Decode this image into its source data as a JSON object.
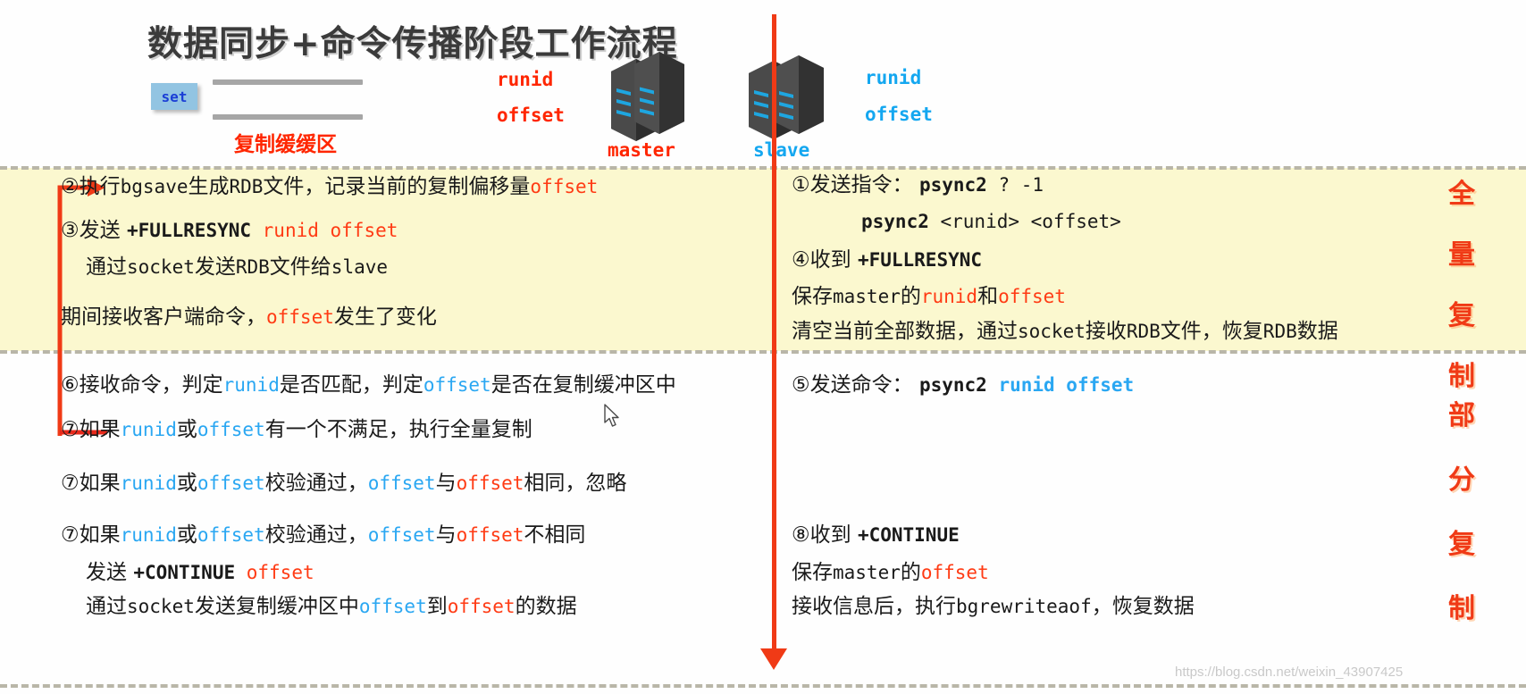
{
  "header": {
    "title": "数据同步+命令传播阶段工作流程",
    "set_box": "set",
    "buffer_label": "复制缓缓区",
    "master": {
      "runid": "runid",
      "offset": "offset",
      "name": "master"
    },
    "slave": {
      "runid": "runid",
      "offset": "offset",
      "name": "slave"
    }
  },
  "side_captions": {
    "full_replication": [
      "全",
      "量",
      "复",
      "制"
    ],
    "partial_replication": [
      "部",
      "分",
      "复",
      "制"
    ]
  },
  "master_panel": {
    "full": [
      {
        "id": "step2",
        "parts": [
          {
            "t": "②执行",
            "c": "black"
          },
          {
            "t": "bgsave",
            "c": "black",
            "mono": true
          },
          {
            "t": "生成",
            "c": "black"
          },
          {
            "t": "RDB",
            "c": "black",
            "mono": true
          },
          {
            "t": "文件，记录当前的复制偏移量",
            "c": "black"
          },
          {
            "t": "offset",
            "c": "red",
            "mono": true
          }
        ]
      },
      {
        "id": "step3",
        "parts": [
          {
            "t": "③发送 ",
            "c": "black"
          },
          {
            "t": "+FULLRESYNC ",
            "c": "black",
            "mono": true,
            "bold": true
          },
          {
            "t": "runid offset",
            "c": "red",
            "mono": true
          }
        ]
      },
      {
        "id": "step3-sub",
        "parts": [
          {
            "t": "通过",
            "c": "black"
          },
          {
            "t": "socket",
            "c": "black",
            "mono": true
          },
          {
            "t": "发送",
            "c": "black"
          },
          {
            "t": "RDB",
            "c": "black",
            "mono": true
          },
          {
            "t": "文件给",
            "c": "black"
          },
          {
            "t": "slave",
            "c": "black",
            "mono": true
          }
        ]
      },
      {
        "id": "note",
        "parts": [
          {
            "t": "期间接收客户端命令，",
            "c": "black"
          },
          {
            "t": "offset",
            "c": "red",
            "mono": true
          },
          {
            "t": "发生了变化",
            "c": "black"
          }
        ]
      }
    ],
    "partial": [
      {
        "id": "step6",
        "parts": [
          {
            "t": "⑥接收命令，判定",
            "c": "black"
          },
          {
            "t": "runid",
            "c": "blue",
            "mono": true
          },
          {
            "t": "是否匹配，判定",
            "c": "black"
          },
          {
            "t": "offset",
            "c": "blue",
            "mono": true
          },
          {
            "t": "是否在复制缓冲区中",
            "c": "black"
          }
        ]
      },
      {
        "id": "step7a",
        "parts": [
          {
            "t": "⑦如果",
            "c": "black"
          },
          {
            "t": "runid",
            "c": "blue",
            "mono": true
          },
          {
            "t": "或",
            "c": "black"
          },
          {
            "t": "offset",
            "c": "blue",
            "mono": true
          },
          {
            "t": "有一个不满足，执行全量复制",
            "c": "black"
          }
        ]
      },
      {
        "id": "step7b",
        "parts": [
          {
            "t": "⑦如果",
            "c": "black"
          },
          {
            "t": "runid",
            "c": "blue",
            "mono": true
          },
          {
            "t": "或",
            "c": "black"
          },
          {
            "t": "offset",
            "c": "blue",
            "mono": true
          },
          {
            "t": "校验通过，",
            "c": "black"
          },
          {
            "t": "offset",
            "c": "blue",
            "mono": true
          },
          {
            "t": "与",
            "c": "black"
          },
          {
            "t": "offset",
            "c": "red",
            "mono": true
          },
          {
            "t": "相同，忽略",
            "c": "black"
          }
        ]
      },
      {
        "id": "step7c",
        "parts": [
          {
            "t": "⑦如果",
            "c": "black"
          },
          {
            "t": "runid",
            "c": "blue",
            "mono": true
          },
          {
            "t": "或",
            "c": "black"
          },
          {
            "t": "offset",
            "c": "blue",
            "mono": true
          },
          {
            "t": "校验通过，",
            "c": "black"
          },
          {
            "t": "offset",
            "c": "blue",
            "mono": true
          },
          {
            "t": "与",
            "c": "black"
          },
          {
            "t": "offset",
            "c": "red",
            "mono": true
          },
          {
            "t": "不相同",
            "c": "black"
          }
        ]
      },
      {
        "id": "step7c-sub1",
        "parts": [
          {
            "t": "发送 ",
            "c": "black"
          },
          {
            "t": "+CONTINUE ",
            "c": "black",
            "mono": true,
            "bold": true
          },
          {
            "t": "offset",
            "c": "red",
            "mono": true
          }
        ]
      },
      {
        "id": "step7c-sub2",
        "parts": [
          {
            "t": "通过",
            "c": "black"
          },
          {
            "t": "socket",
            "c": "black",
            "mono": true
          },
          {
            "t": "发送复制缓冲区中",
            "c": "black"
          },
          {
            "t": "offset",
            "c": "blue",
            "mono": true
          },
          {
            "t": "到",
            "c": "black"
          },
          {
            "t": "offset",
            "c": "red",
            "mono": true
          },
          {
            "t": "的数据",
            "c": "black"
          }
        ]
      }
    ]
  },
  "slave_panel": {
    "full": [
      {
        "id": "step1",
        "parts": [
          {
            "t": "①发送指令： ",
            "c": "black"
          },
          {
            "t": "psync2",
            "c": "black",
            "mono": true,
            "bold": true
          },
          {
            "t": "  ? -1",
            "c": "black",
            "mono": true
          }
        ]
      },
      {
        "id": "step1-sub",
        "parts": [
          {
            "t": "psync2",
            "c": "black",
            "mono": true,
            "bold": true
          },
          {
            "t": "  <runid> <offset>",
            "c": "black",
            "mono": true
          }
        ]
      },
      {
        "id": "step4",
        "parts": [
          {
            "t": "④收到 ",
            "c": "black"
          },
          {
            "t": "+FULLRESYNC",
            "c": "black",
            "mono": true,
            "bold": true
          }
        ]
      },
      {
        "id": "step4-sub1",
        "parts": [
          {
            "t": "保存",
            "c": "black"
          },
          {
            "t": "master",
            "c": "black",
            "mono": true
          },
          {
            "t": "的",
            "c": "black"
          },
          {
            "t": "runid",
            "c": "red",
            "mono": true
          },
          {
            "t": "和",
            "c": "black"
          },
          {
            "t": "offset",
            "c": "red",
            "mono": true
          }
        ]
      },
      {
        "id": "step4-sub2",
        "parts": [
          {
            "t": "清空当前全部数据，通过",
            "c": "black"
          },
          {
            "t": "socket",
            "c": "black",
            "mono": true
          },
          {
            "t": "接收",
            "c": "black"
          },
          {
            "t": "RDB",
            "c": "black",
            "mono": true
          },
          {
            "t": "文件，恢复",
            "c": "black"
          },
          {
            "t": "RDB",
            "c": "black",
            "mono": true
          },
          {
            "t": "数据",
            "c": "black"
          }
        ]
      }
    ],
    "partial": [
      {
        "id": "step5",
        "parts": [
          {
            "t": "⑤发送命令： ",
            "c": "black"
          },
          {
            "t": "psync2",
            "c": "black",
            "mono": true,
            "bold": true
          },
          {
            "t": "  runid offset",
            "c": "blue",
            "mono": true,
            "bold": true
          }
        ]
      },
      {
        "id": "step8",
        "parts": [
          {
            "t": "⑧收到 ",
            "c": "black"
          },
          {
            "t": "+CONTINUE",
            "c": "black",
            "mono": true,
            "bold": true
          }
        ]
      },
      {
        "id": "step8-sub1",
        "parts": [
          {
            "t": "保存",
            "c": "black"
          },
          {
            "t": "master",
            "c": "black",
            "mono": true
          },
          {
            "t": "的",
            "c": "black"
          },
          {
            "t": "offset",
            "c": "red",
            "mono": true
          }
        ]
      },
      {
        "id": "step8-sub2",
        "parts": [
          {
            "t": "接收信息后，执行",
            "c": "black"
          },
          {
            "t": "bgrewriteaof",
            "c": "black",
            "mono": true
          },
          {
            "t": "，恢复数据",
            "c": "black"
          }
        ]
      }
    ]
  },
  "watermark": "https://blog.csdn.net/weixin_43907425",
  "colors": {
    "red": "#ff3b14",
    "blue": "#2aa7f2",
    "band": "#fbf8cf",
    "divider": "#f03a16",
    "set_box": "#92c4e2"
  }
}
